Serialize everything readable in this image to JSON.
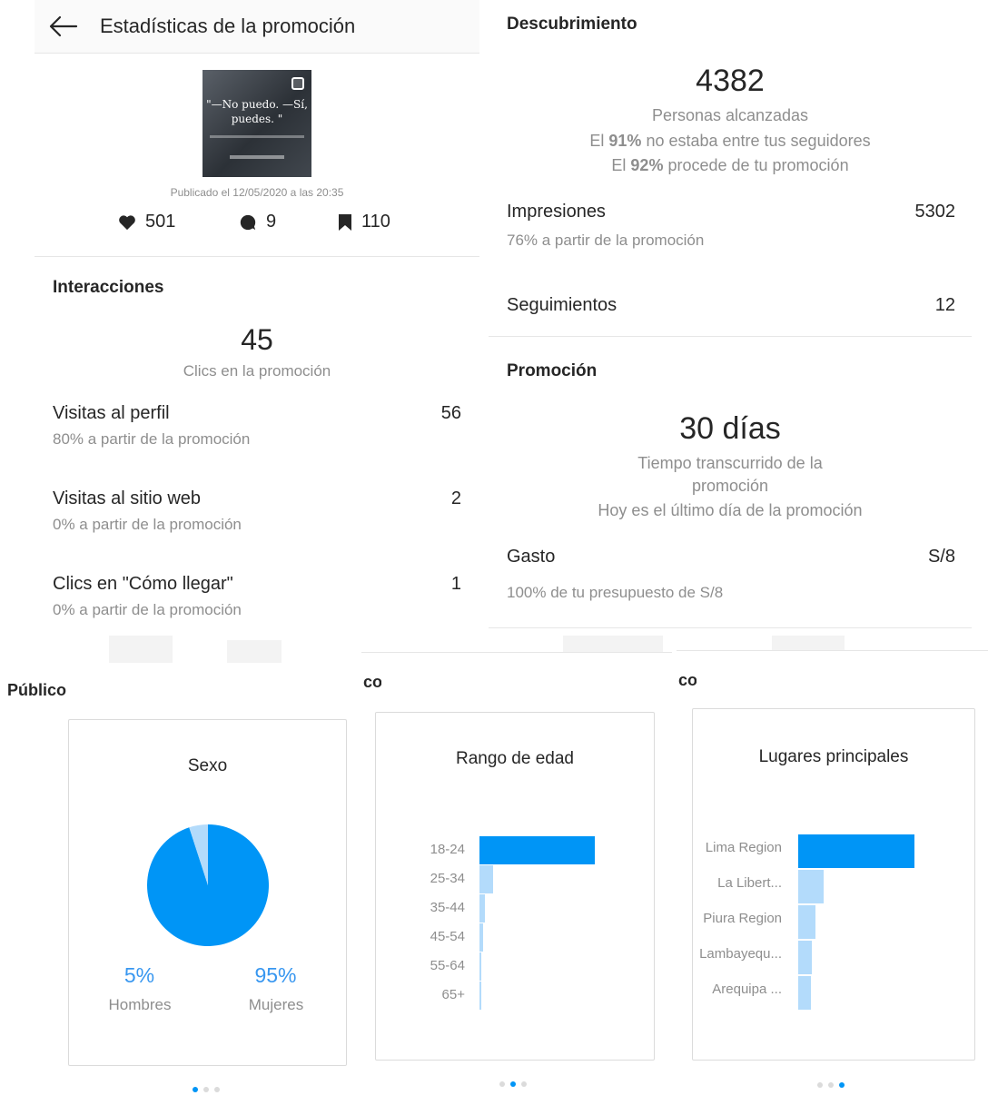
{
  "header": {
    "title": "Estadísticas de la promoción"
  },
  "post": {
    "quote": "\"—No puedo. —Sí, puedes. \"",
    "published": "Publicado el 12/05/2020 a las 20:35",
    "likes": "501",
    "comments": "9",
    "saves": "110"
  },
  "interactions": {
    "title": "Interacciones",
    "clicks": "45",
    "clicks_label": "Clics en la promoción",
    "rows": [
      {
        "label": "Visitas al perfil",
        "value": "56",
        "sub": "80% a partir de la promoción"
      },
      {
        "label": "Visitas al sitio web",
        "value": "2",
        "sub": "0% a partir de la promoción"
      },
      {
        "label": "Clics en \"Cómo llegar\"",
        "value": "1",
        "sub": "0% a partir de la promoción"
      }
    ]
  },
  "discovery": {
    "title": "Descubrimiento",
    "reach": "4382",
    "reach_label": "Personas alcanzadas",
    "line1_pre": "El ",
    "line1_bold": "91%",
    "line1_post": " no estaba entre tus seguidores",
    "line2_pre": "El ",
    "line2_bold": "92%",
    "line2_post": " procede de tu promoción",
    "impressions_label": "Impresiones",
    "impressions_value": "5302",
    "impressions_sub": "76% a partir de la promoción",
    "follows_label": "Seguimientos",
    "follows_value": "12"
  },
  "promotion": {
    "title": "Promoción",
    "duration": "30 días",
    "duration_label_1": "Tiempo transcurrido de la",
    "duration_label_2": "promoción",
    "last_day": "Hoy es el último día de la promoción",
    "spend_label": "Gasto",
    "spend_value": "S/8",
    "spend_sub": "100% de tu presupuesto de S/8"
  },
  "audience": {
    "title": "Público",
    "title_fragment_2": "co",
    "title_fragment_3": "co",
    "colors": {
      "primary": "#0095f6",
      "secondary": "#b3dbfb",
      "accent_text": "#3897f0"
    },
    "gender": {
      "title": "Sexo",
      "men_pct": "5%",
      "men_label": "Hombres",
      "women_pct": "95%",
      "women_label": "Mujeres",
      "men_value": 5,
      "women_value": 95
    },
    "age": {
      "title": "Rango de edad",
      "categories": [
        "18-24",
        "25-34",
        "35-44",
        "45-54",
        "55-64",
        "65+"
      ],
      "values": [
        100,
        12,
        5,
        3,
        1.5,
        1
      ]
    },
    "places": {
      "title": "Lugares principales",
      "categories": [
        "Lima Region",
        "La Libert...",
        "Piura Region",
        "Lambayequ...",
        "Arequipa ..."
      ],
      "values": [
        100,
        22,
        15,
        12,
        11
      ]
    }
  },
  "chart_data": [
    {
      "type": "pie",
      "title": "Sexo",
      "categories": [
        "Hombres",
        "Mujeres"
      ],
      "values": [
        5,
        95
      ]
    },
    {
      "type": "bar",
      "title": "Rango de edad",
      "categories": [
        "18-24",
        "25-34",
        "35-44",
        "45-54",
        "55-64",
        "65+"
      ],
      "values": [
        100,
        12,
        5,
        3,
        1.5,
        1
      ]
    },
    {
      "type": "bar",
      "title": "Lugares principales",
      "categories": [
        "Lima Region",
        "La Libert...",
        "Piura Region",
        "Lambayequ...",
        "Arequipa ..."
      ],
      "values": [
        100,
        22,
        15,
        12,
        11
      ]
    }
  ]
}
